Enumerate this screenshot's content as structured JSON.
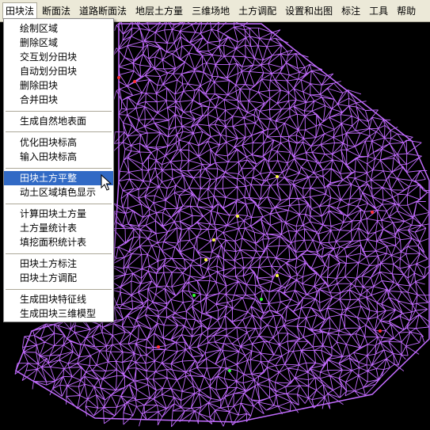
{
  "menubar": {
    "items": [
      "田块法",
      "断面法",
      "道路断面法",
      "地层土方量",
      "三维场地",
      "土方调配",
      "设置和出图",
      "标注",
      "工具",
      "帮助"
    ],
    "active_index": 0
  },
  "dropdown": {
    "groups": [
      [
        "绘制区域",
        "删除区域",
        "交互划分田块",
        "自动划分田块",
        "删除田块",
        "合并田块"
      ],
      [
        "生成自然地表面"
      ],
      [
        "优化田块标高",
        "输入田块标高"
      ],
      [
        "田块土方平整",
        "动土区域填色显示"
      ],
      [
        "计算田块土方量",
        "土方量统计表",
        "填挖面积统计表"
      ],
      [
        "田块土方标注",
        "田块土方调配"
      ],
      [
        "生成田块特征线",
        "生成田块三维模型"
      ]
    ],
    "highlighted": "田块土方平整"
  },
  "colors": {
    "mesh": "#c26cff",
    "canvas_bg": "#000000",
    "menu_bg": "#ece9d8",
    "highlight": "#316ac5"
  }
}
